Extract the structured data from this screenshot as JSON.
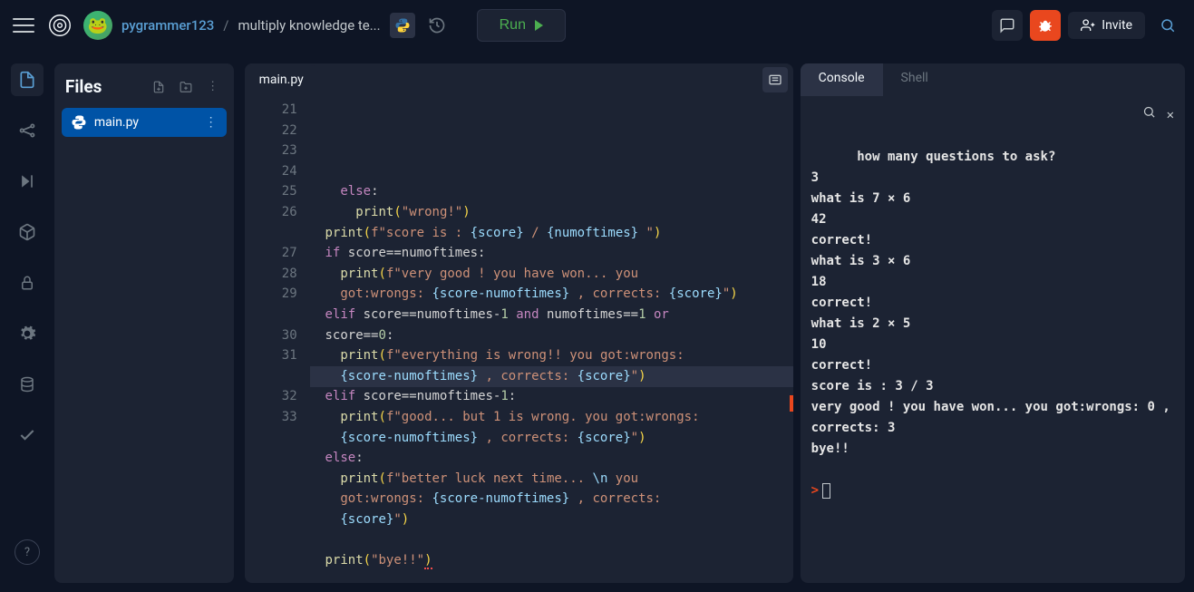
{
  "header": {
    "username": "pygrammer123",
    "repo": "multiply knowledge te...",
    "run_label": "Run",
    "invite_label": "Invite"
  },
  "sidebar": {
    "files_title": "Files",
    "active_file": "main.py"
  },
  "editor": {
    "tab": "main.py",
    "gutter": [
      "21",
      "22",
      "23",
      "24",
      "25",
      "26",
      "",
      "27",
      "28",
      "29",
      "",
      "30",
      "31",
      "",
      "32",
      "33"
    ],
    "lines": [
      {
        "indent": 2,
        "seg": [
          {
            "t": "else",
            "c": "k-kw"
          },
          {
            "t": ":",
            "c": "k-op"
          }
        ]
      },
      {
        "indent": 3,
        "seg": [
          {
            "t": "print",
            "c": "k-fn"
          },
          {
            "t": "(",
            "c": "k-pun"
          },
          {
            "t": "\"wrong!\"",
            "c": "k-str"
          },
          {
            "t": ")",
            "c": "k-pun"
          }
        ]
      },
      {
        "indent": 1,
        "seg": [
          {
            "t": "print",
            "c": "k-fn"
          },
          {
            "t": "(",
            "c": "k-pun"
          },
          {
            "t": "f\"score is : ",
            "c": "k-str"
          },
          {
            "t": "{score}",
            "c": "k-var"
          },
          {
            "t": " / ",
            "c": "k-str"
          },
          {
            "t": "{numoftimes}",
            "c": "k-var"
          },
          {
            "t": " \"",
            "c": "k-str"
          },
          {
            "t": ")",
            "c": "k-pun"
          }
        ]
      },
      {
        "indent": 1,
        "seg": [
          {
            "t": "if",
            "c": "k-kw"
          },
          {
            "t": " score",
            "c": "k-op"
          },
          {
            "t": "==",
            "c": "k-op"
          },
          {
            "t": "numoftimes",
            "c": "k-op"
          },
          {
            "t": ":",
            "c": "k-op"
          }
        ]
      },
      {
        "indent": 2,
        "seg": [
          {
            "t": "print",
            "c": "k-fn"
          },
          {
            "t": "(",
            "c": "k-pun"
          },
          {
            "t": "f\"very good ! you have won... you got:wrongs: ",
            "c": "k-str"
          },
          {
            "t": "{score-numoftimes}",
            "c": "k-var"
          },
          {
            "t": " , corrects: ",
            "c": "k-str"
          },
          {
            "t": "{score}",
            "c": "k-var"
          },
          {
            "t": "\"",
            "c": "k-str"
          },
          {
            "t": ")",
            "c": "k-pun"
          }
        ],
        "wrap": 48
      },
      {
        "indent": 1,
        "seg": [
          {
            "t": "elif",
            "c": "k-kw"
          },
          {
            "t": " score",
            "c": "k-op"
          },
          {
            "t": "==",
            "c": "k-op"
          },
          {
            "t": "numoftimes",
            "c": "k-op"
          },
          {
            "t": "-",
            "c": "k-op"
          },
          {
            "t": "1",
            "c": "k-num"
          },
          {
            "t": " ",
            "c": ""
          },
          {
            "t": "and",
            "c": "k-kw"
          },
          {
            "t": " numoftimes",
            "c": "k-op"
          },
          {
            "t": "==",
            "c": "k-op"
          },
          {
            "t": "1",
            "c": "k-num"
          },
          {
            "t": " ",
            "c": ""
          },
          {
            "t": "or",
            "c": "k-kw"
          },
          {
            "t": " score",
            "c": "k-op"
          },
          {
            "t": "==",
            "c": "k-op"
          },
          {
            "t": "0",
            "c": "k-num"
          },
          {
            "t": ":",
            "c": "k-op"
          }
        ],
        "wrap": 51
      },
      {
        "indent": 2,
        "seg": [
          {
            "t": "print",
            "c": "k-fn"
          },
          {
            "t": "(",
            "c": "k-pun"
          },
          {
            "t": "f\"everything is wrong!! you got:wrongs: ",
            "c": "k-str"
          },
          {
            "t": "{score-numoftimes}",
            "c": "k-var"
          },
          {
            "t": " , corrects: ",
            "c": "k-str"
          },
          {
            "t": "{score}",
            "c": "k-var"
          },
          {
            "t": "\"",
            "c": "k-str"
          },
          {
            "t": ")",
            "c": "k-pun"
          }
        ],
        "wrap": 48
      },
      {
        "indent": 1,
        "seg": [
          {
            "t": "elif",
            "c": "k-kw"
          },
          {
            "t": " score",
            "c": "k-op"
          },
          {
            "t": "==",
            "c": "k-op"
          },
          {
            "t": "numoftimes",
            "c": "k-op"
          },
          {
            "t": "-",
            "c": "k-op"
          },
          {
            "t": "1",
            "c": "k-num"
          },
          {
            "t": ":",
            "c": "k-op"
          }
        ]
      },
      {
        "indent": 2,
        "seg": [
          {
            "t": "print",
            "c": "k-fn"
          },
          {
            "t": "(",
            "c": "k-pun"
          },
          {
            "t": "f\"good... but 1 is wrong. you got:wrongs: ",
            "c": "k-str"
          },
          {
            "t": "{score-numoftimes}",
            "c": "k-var"
          },
          {
            "t": " , corrects: ",
            "c": "k-str"
          },
          {
            "t": "{score}",
            "c": "k-var"
          },
          {
            "t": "\"",
            "c": "k-str"
          },
          {
            "t": ")",
            "c": "k-pun"
          }
        ],
        "wrap": 48
      },
      {
        "indent": 1,
        "seg": [
          {
            "t": "else",
            "c": "k-kw"
          },
          {
            "t": ":",
            "c": "k-op"
          }
        ]
      },
      {
        "indent": 2,
        "seg": [
          {
            "t": "print",
            "c": "k-fn"
          },
          {
            "t": "(",
            "c": "k-pun"
          },
          {
            "t": "f\"better luck next time... ",
            "c": "k-str"
          },
          {
            "t": "\\n",
            "c": "k-var"
          },
          {
            "t": " you got:wrongs: ",
            "c": "k-str"
          },
          {
            "t": "{score-numoftimes}",
            "c": "k-var"
          },
          {
            "t": " , corrects: ",
            "c": "k-str"
          },
          {
            "t": "{score}",
            "c": "k-var"
          },
          {
            "t": "\"",
            "c": "k-str"
          },
          {
            "t": ")",
            "c": "k-pun"
          }
        ],
        "wrap": 44
      },
      {
        "indent": 1,
        "seg": []
      },
      {
        "indent": 1,
        "seg": [
          {
            "t": "print",
            "c": "k-fn"
          },
          {
            "t": "(",
            "c": "k-pun"
          },
          {
            "t": "\"bye!!\"",
            "c": "k-str"
          },
          {
            "t": ")",
            "c": "k-pun err-mark"
          }
        ]
      }
    ]
  },
  "console": {
    "tab_console": "Console",
    "tab_shell": "Shell",
    "output": "how many questions to ask?\n3\nwhat is 7 × 6\n42\ncorrect!\nwhat is 3 × 6\n18\ncorrect!\nwhat is 2 × 5\n10\ncorrect!\nscore is : 3 / 3\nvery good ! you have won... you got:wrongs: 0 , corrects: 3\nbye!!"
  }
}
